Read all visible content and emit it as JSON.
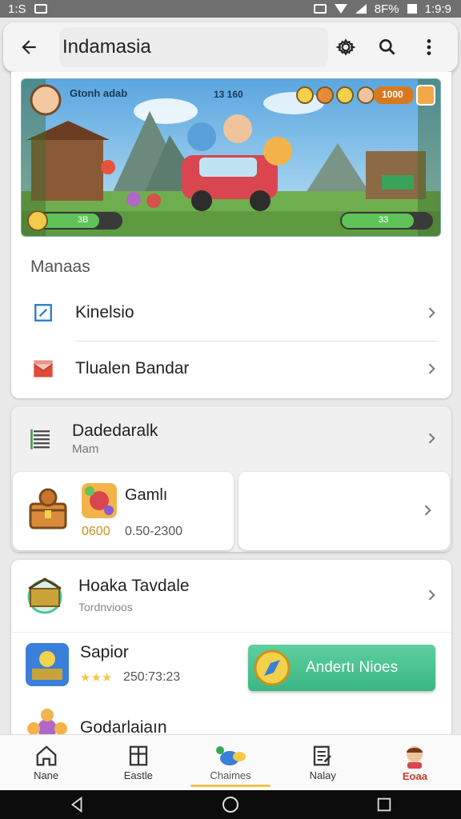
{
  "status_bar": {
    "time_left": "1:S",
    "time_right": "1:9:9",
    "battery_text": "8F%"
  },
  "app_bar": {
    "title": "Indamasia"
  },
  "banner": {
    "top_label": "Gtonh adab",
    "score": "13 160",
    "counter": "1000",
    "left_bar_text": "3B",
    "right_bar_text": "33"
  },
  "menu_section": {
    "header": "Manaas",
    "items": [
      {
        "label": "Kinelsio",
        "icon": "edit-icon"
      },
      {
        "label": "Tlualen Bandar",
        "icon": "mail-icon"
      }
    ]
  },
  "dashboard": {
    "title": "Dadedaralk",
    "subtitle": "Mam",
    "game_tile": {
      "title": "Gamlı",
      "coins": "0600",
      "range": "0.50-2300"
    }
  },
  "list": {
    "items": [
      {
        "title": "Hoaka Tavdale",
        "subtitle": "Tordnvioos"
      },
      {
        "title": "Sapior",
        "meta": "250:73:23"
      },
      {
        "title": "Godarlaiaın"
      }
    ],
    "action_button": "Andertı Nioes"
  },
  "bottom_nav": {
    "items": [
      {
        "label": "Nane",
        "icon": "home-icon"
      },
      {
        "label": "Eastle",
        "icon": "grid-icon"
      },
      {
        "label": "Chaimes",
        "icon": "birds-icon"
      },
      {
        "label": "Nalay",
        "icon": "document-icon"
      },
      {
        "label": "Eoaa",
        "icon": "avatar-icon"
      }
    ],
    "active_index": 2
  },
  "colors": {
    "accent_green": "#3ab784",
    "active_underline": "#f0c64a",
    "profile_red": "#c83a2a"
  }
}
